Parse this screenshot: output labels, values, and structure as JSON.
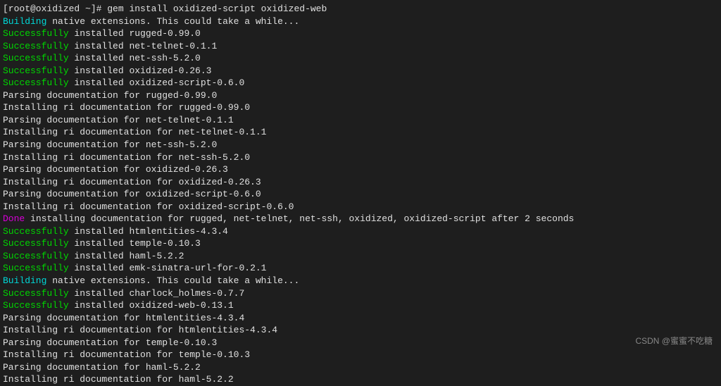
{
  "prompt": {
    "user_host": "[root@oxidized ~]#",
    "command": " gem install oxidized-script oxidized-web"
  },
  "lines": [
    {
      "segments": [
        {
          "cls": "cyan",
          "txt": "Building"
        },
        {
          "cls": "white",
          "txt": " native extensions. This could take a while..."
        }
      ]
    },
    {
      "segments": [
        {
          "cls": "green",
          "txt": "Successfully"
        },
        {
          "cls": "white",
          "txt": " installed rugged-0.99.0"
        }
      ]
    },
    {
      "segments": [
        {
          "cls": "green",
          "txt": "Successfully"
        },
        {
          "cls": "white",
          "txt": " installed net-telnet-0.1.1"
        }
      ]
    },
    {
      "segments": [
        {
          "cls": "green",
          "txt": "Successfully"
        },
        {
          "cls": "white",
          "txt": " installed net-ssh-5.2.0"
        }
      ]
    },
    {
      "segments": [
        {
          "cls": "green",
          "txt": "Successfully"
        },
        {
          "cls": "white",
          "txt": " installed oxidized-0.26.3"
        }
      ]
    },
    {
      "segments": [
        {
          "cls": "green",
          "txt": "Successfully"
        },
        {
          "cls": "white",
          "txt": " installed oxidized-script-0.6.0"
        }
      ]
    },
    {
      "segments": [
        {
          "cls": "white",
          "txt": "Parsing documentation for rugged-0.99.0"
        }
      ]
    },
    {
      "segments": [
        {
          "cls": "white",
          "txt": "Installing ri documentation for rugged-0.99.0"
        }
      ]
    },
    {
      "segments": [
        {
          "cls": "white",
          "txt": "Parsing documentation for net-telnet-0.1.1"
        }
      ]
    },
    {
      "segments": [
        {
          "cls": "white",
          "txt": "Installing ri documentation for net-telnet-0.1.1"
        }
      ]
    },
    {
      "segments": [
        {
          "cls": "white",
          "txt": "Parsing documentation for net-ssh-5.2.0"
        }
      ]
    },
    {
      "segments": [
        {
          "cls": "white",
          "txt": "Installing ri documentation for net-ssh-5.2.0"
        }
      ]
    },
    {
      "segments": [
        {
          "cls": "white",
          "txt": "Parsing documentation for oxidized-0.26.3"
        }
      ]
    },
    {
      "segments": [
        {
          "cls": "white",
          "txt": "Installing ri documentation for oxidized-0.26.3"
        }
      ]
    },
    {
      "segments": [
        {
          "cls": "white",
          "txt": "Parsing documentation for oxidized-script-0.6.0"
        }
      ]
    },
    {
      "segments": [
        {
          "cls": "white",
          "txt": "Installing ri documentation for oxidized-script-0.6.0"
        }
      ]
    },
    {
      "segments": [
        {
          "cls": "magenta",
          "txt": "Done"
        },
        {
          "cls": "white",
          "txt": " installing documentation for rugged, net-telnet, net-ssh, oxidized, oxidized-script after 2 seconds"
        }
      ]
    },
    {
      "segments": [
        {
          "cls": "green",
          "txt": "Successfully"
        },
        {
          "cls": "white",
          "txt": " installed htmlentities-4.3.4"
        }
      ]
    },
    {
      "segments": [
        {
          "cls": "green",
          "txt": "Successfully"
        },
        {
          "cls": "white",
          "txt": " installed temple-0.10.3"
        }
      ]
    },
    {
      "segments": [
        {
          "cls": "green",
          "txt": "Successfully"
        },
        {
          "cls": "white",
          "txt": " installed haml-5.2.2"
        }
      ]
    },
    {
      "segments": [
        {
          "cls": "green",
          "txt": "Successfully"
        },
        {
          "cls": "white",
          "txt": " installed emk-sinatra-url-for-0.2.1"
        }
      ]
    },
    {
      "segments": [
        {
          "cls": "cyan",
          "txt": "Building"
        },
        {
          "cls": "white",
          "txt": " native extensions. This could take a while..."
        }
      ]
    },
    {
      "segments": [
        {
          "cls": "green",
          "txt": "Successfully"
        },
        {
          "cls": "white",
          "txt": " installed charlock_holmes-0.7.7"
        }
      ]
    },
    {
      "segments": [
        {
          "cls": "green",
          "txt": "Successfully"
        },
        {
          "cls": "white",
          "txt": " installed oxidized-web-0.13.1"
        }
      ]
    },
    {
      "segments": [
        {
          "cls": "white",
          "txt": "Parsing documentation for htmlentities-4.3.4"
        }
      ]
    },
    {
      "segments": [
        {
          "cls": "white",
          "txt": "Installing ri documentation for htmlentities-4.3.4"
        }
      ]
    },
    {
      "segments": [
        {
          "cls": "white",
          "txt": "Parsing documentation for temple-0.10.3"
        }
      ]
    },
    {
      "segments": [
        {
          "cls": "white",
          "txt": "Installing ri documentation for temple-0.10.3"
        }
      ]
    },
    {
      "segments": [
        {
          "cls": "white",
          "txt": "Parsing documentation for haml-5.2.2"
        }
      ]
    },
    {
      "segments": [
        {
          "cls": "white",
          "txt": "Installing ri documentation for haml-5.2.2"
        }
      ]
    }
  ],
  "watermark": "CSDN @蜜蜜不吃糖"
}
